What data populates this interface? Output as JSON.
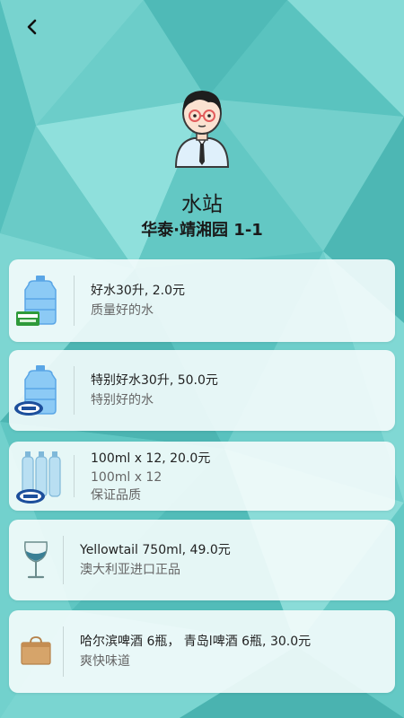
{
  "header": {
    "back_icon": "chevron-left-icon"
  },
  "station": {
    "avatar_icon": "person-avatar-icon",
    "name": "水站",
    "address": "华泰·靖湘园 1-1"
  },
  "products": [
    {
      "icon": "water-jug-cestbon-icon",
      "title": "好水30升, 2.0元",
      "subtitles": [
        "质量好的水"
      ]
    },
    {
      "icon": "water-jug-quechao-icon",
      "title": "特别好水30升, 50.0元",
      "subtitles": [
        "特别好的水"
      ]
    },
    {
      "icon": "water-bottles-quechao-icon",
      "title": "100ml x 12, 20.0元",
      "subtitles": [
        "100ml x 12",
        "保证品质"
      ]
    },
    {
      "icon": "wine-glass-icon",
      "title": "Yellowtail 750ml, 49.0元",
      "subtitles": [
        "澳大利亚进口正品"
      ]
    },
    {
      "icon": "box-icon",
      "title": "哈尔滨啤酒 6瓶， 青岛l啤酒 6瓶, 30.0元",
      "subtitles": [
        "爽快味道"
      ]
    }
  ],
  "colors": {
    "background": "#5ec7c3",
    "card": "#f5fcfc"
  }
}
